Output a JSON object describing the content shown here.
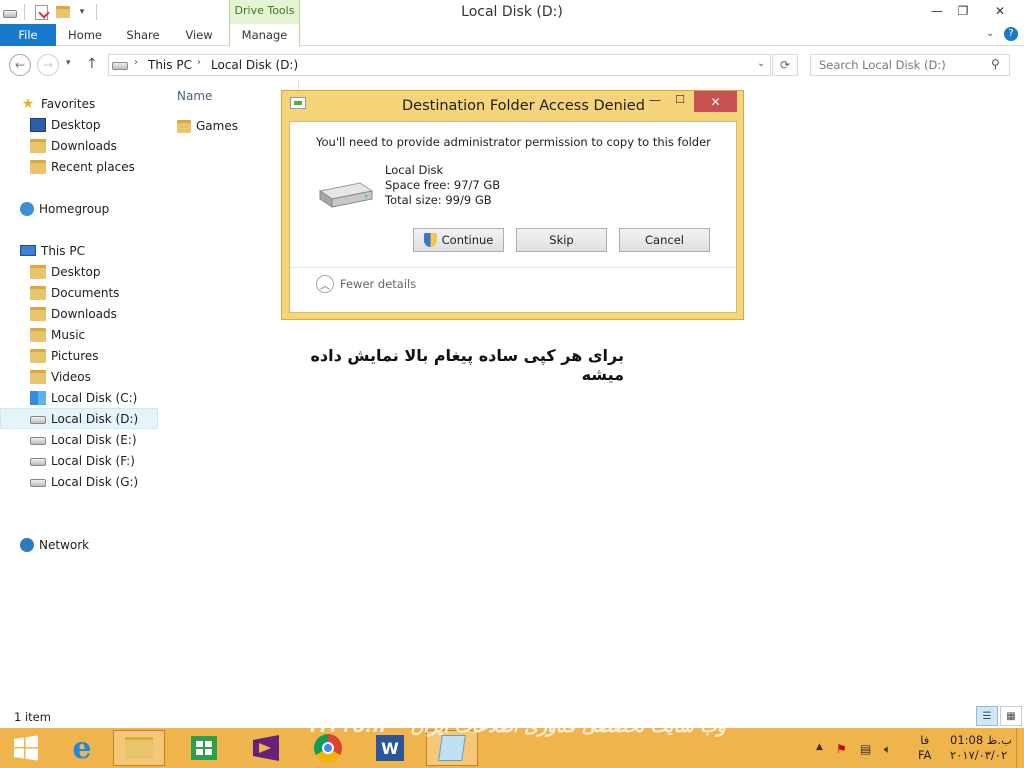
{
  "window": {
    "title": "Local Disk (D:)",
    "contextual_tab": "Drive Tools"
  },
  "ribbon": {
    "tabs": [
      "File",
      "Home",
      "Share",
      "View",
      "Manage"
    ]
  },
  "address_bar": {
    "crumbs": [
      "This PC",
      "Local Disk (D:)"
    ],
    "search_placeholder": "Search Local Disk (D:)"
  },
  "nav_pane": {
    "favorites": {
      "label": "Favorites",
      "items": [
        "Desktop",
        "Downloads",
        "Recent places"
      ]
    },
    "homegroup": "Homegroup",
    "this_pc": {
      "label": "This PC",
      "items": [
        "Desktop",
        "Documents",
        "Downloads",
        "Music",
        "Pictures",
        "Videos",
        "Local Disk (C:)",
        "Local Disk (D:)",
        "Local Disk (E:)",
        "Local Disk (F:)",
        "Local Disk (G:)"
      ]
    },
    "network": "Network",
    "selected": "Local Disk (D:)"
  },
  "content": {
    "column_name": "Name",
    "files": [
      "Games"
    ]
  },
  "dialog": {
    "title": "Destination Folder Access Denied",
    "message": "You'll need to provide administrator permission to copy to this folder",
    "disk_name": "Local Disk",
    "space_free": "Space free: 97/7 GB",
    "total_size": "Total size: 99/9 GB",
    "buttons": {
      "continue": "Continue",
      "skip": "Skip",
      "cancel": "Cancel"
    },
    "fewer_details": "Fewer details"
  },
  "annotation": "برای هر کپی ساده پیغام بالا نمایش داده میشه",
  "status_bar": {
    "item_count": "1 item"
  },
  "taskbar": {
    "watermark": "ITPro.ir - وب سایت تخصصی فناوری اطلاعات ایران",
    "language_top": "فا",
    "language_bottom": "FA",
    "time": "01:08 ب.ظ",
    "date": "۲۰۱۷/۰۳/۰۲"
  },
  "colors": {
    "file_tab": "#1979ca",
    "dialog_frame": "#f6d47a",
    "taskbar": "#f0b44c",
    "close_button": "#c75050"
  }
}
